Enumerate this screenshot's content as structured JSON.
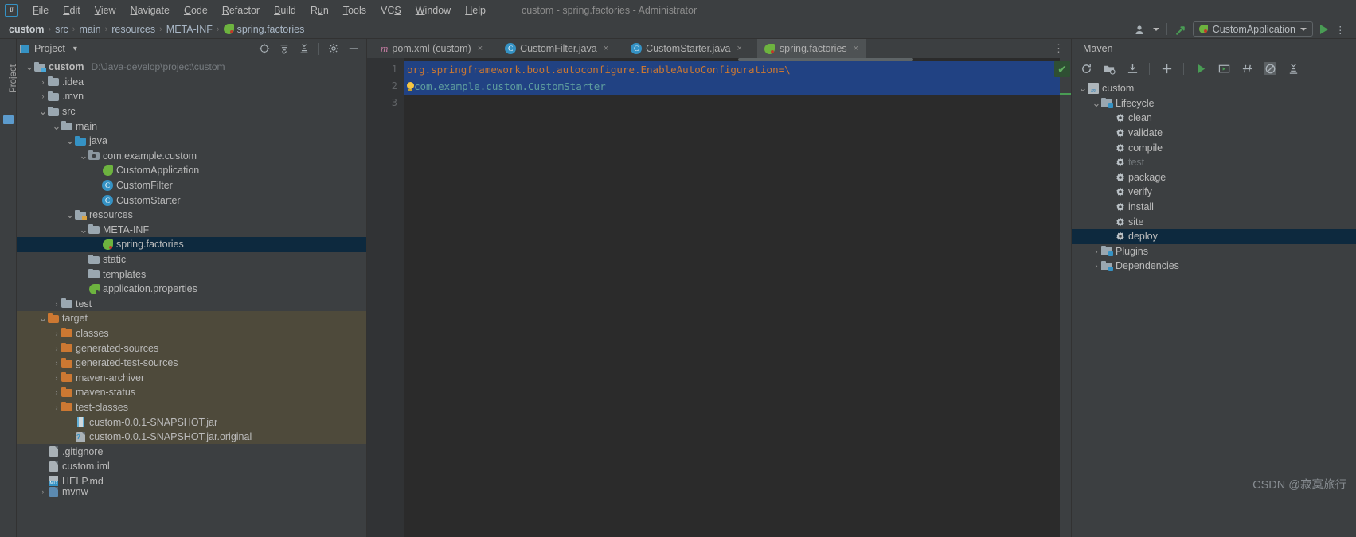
{
  "window": {
    "title": "custom - spring.factories - Administrator"
  },
  "menubar": {
    "logo": "ij-logo",
    "items": [
      "File",
      "Edit",
      "View",
      "Navigate",
      "Code",
      "Refactor",
      "Build",
      "Run",
      "Tools",
      "VCS",
      "Window",
      "Help"
    ]
  },
  "breadcrumb": {
    "items": [
      "custom",
      "src",
      "main",
      "resources",
      "META-INF",
      "spring.factories"
    ],
    "separator": "›"
  },
  "nav_right": {
    "profile_icon": "user-icon",
    "build_icon": "hammer-icon",
    "run_config": "CustomApplication",
    "run_icon": "run-icon",
    "more_icon": "more-icon"
  },
  "left_strip": {
    "label": "Project"
  },
  "project_panel": {
    "title": "Project",
    "dropdown": "▾",
    "toolbar_icons": [
      "locate-icon",
      "expand-all-icon",
      "collapse-all-icon",
      "settings-gear-icon",
      "hide-icon"
    ],
    "tree": [
      {
        "label": "custom",
        "path": "D:\\Java-develop\\project\\custom",
        "depth": 0,
        "arrow": "∨",
        "icon": "module-folder-icon",
        "bold": true
      },
      {
        "label": ".idea",
        "depth": 1,
        "arrow": "›",
        "icon": "folder-icon"
      },
      {
        "label": ".mvn",
        "depth": 1,
        "arrow": "›",
        "icon": "folder-icon"
      },
      {
        "label": "src",
        "depth": 1,
        "arrow": "∨",
        "icon": "folder-icon"
      },
      {
        "label": "main",
        "depth": 2,
        "arrow": "∨",
        "icon": "folder-icon"
      },
      {
        "label": "java",
        "depth": 3,
        "arrow": "∨",
        "icon": "source-folder-icon"
      },
      {
        "label": "com.example.custom",
        "depth": 4,
        "arrow": "∨",
        "icon": "package-icon"
      },
      {
        "label": "CustomApplication",
        "depth": 5,
        "arrow": "",
        "icon": "spring-class-icon"
      },
      {
        "label": "CustomFilter",
        "depth": 5,
        "arrow": "",
        "icon": "class-icon"
      },
      {
        "label": "CustomStarter",
        "depth": 5,
        "arrow": "",
        "icon": "class-icon"
      },
      {
        "label": "resources",
        "depth": 3,
        "arrow": "∨",
        "icon": "resource-folder-icon"
      },
      {
        "label": "META-INF",
        "depth": 4,
        "arrow": "∨",
        "icon": "folder-icon"
      },
      {
        "label": "spring.factories",
        "depth": 5,
        "arrow": "",
        "icon": "spring-leaf-icon",
        "selected": true
      },
      {
        "label": "static",
        "depth": 4,
        "arrow": "",
        "icon": "folder-icon"
      },
      {
        "label": "templates",
        "depth": 4,
        "arrow": "",
        "icon": "folder-icon"
      },
      {
        "label": "application.properties",
        "depth": 4,
        "arrow": "",
        "icon": "spring-properties-icon"
      },
      {
        "label": "test",
        "depth": 2,
        "arrow": "›",
        "icon": "folder-icon"
      },
      {
        "label": "target",
        "depth": 1,
        "arrow": "∨",
        "icon": "excluded-folder-icon",
        "excluded": true
      },
      {
        "label": "classes",
        "depth": 2,
        "arrow": "›",
        "icon": "excluded-folder-icon",
        "excluded": true
      },
      {
        "label": "generated-sources",
        "depth": 2,
        "arrow": "›",
        "icon": "excluded-folder-icon",
        "excluded": true
      },
      {
        "label": "generated-test-sources",
        "depth": 2,
        "arrow": "›",
        "icon": "excluded-folder-icon",
        "excluded": true
      },
      {
        "label": "maven-archiver",
        "depth": 2,
        "arrow": "›",
        "icon": "excluded-folder-icon",
        "excluded": true
      },
      {
        "label": "maven-status",
        "depth": 2,
        "arrow": "›",
        "icon": "excluded-folder-icon",
        "excluded": true
      },
      {
        "label": "test-classes",
        "depth": 2,
        "arrow": "›",
        "icon": "excluded-folder-icon",
        "excluded": true
      },
      {
        "label": "custom-0.0.1-SNAPSHOT.jar",
        "depth": 3,
        "arrow": "",
        "icon": "jar-icon",
        "excluded": true
      },
      {
        "label": "custom-0.0.1-SNAPSHOT.jar.original",
        "depth": 3,
        "arrow": "",
        "icon": "unknown-file-icon",
        "excluded": true
      },
      {
        "label": ".gitignore",
        "depth": 1,
        "arrow": "",
        "icon": "gitignore-icon"
      },
      {
        "label": "custom.iml",
        "depth": 1,
        "arrow": "",
        "icon": "iml-file-icon"
      },
      {
        "label": "HELP.md",
        "depth": 1,
        "arrow": "",
        "icon": "markdown-icon"
      },
      {
        "label": "mvnw",
        "depth": 1,
        "arrow": "›",
        "icon": "script-icon",
        "clipped": true
      }
    ]
  },
  "editor": {
    "tabs": [
      {
        "label": "pom.xml (custom)",
        "icon": "maven-icon",
        "active": false,
        "close": "×"
      },
      {
        "label": "CustomFilter.java",
        "icon": "class-icon",
        "active": false,
        "close": "×"
      },
      {
        "label": "CustomStarter.java",
        "icon": "class-icon",
        "active": false,
        "close": "×"
      },
      {
        "label": "spring.factories",
        "icon": "spring-leaf-icon",
        "active": true,
        "close": "×"
      }
    ],
    "tabs_overflow_icon": "more-vertical-icon",
    "gutter_lines": [
      "1",
      "2",
      "3"
    ],
    "lines": [
      {
        "num": "1",
        "text": "org.springframework.boot.autoconfigure.EnableAutoConfiguration=\\",
        "highlighted": true,
        "color": "#cc7832"
      },
      {
        "num": "2",
        "text": "com.example.custom.CustomStarter",
        "highlighted": true,
        "color": "#5f9e9e",
        "bulb": true
      },
      {
        "num": "3",
        "text": "",
        "highlighted": false,
        "color": "#a9b7c6"
      }
    ],
    "inspection_badge": "✔",
    "colors": {
      "selection": "#214283",
      "bg": "#2b2b2b",
      "gutter_bg": "#313335"
    }
  },
  "maven_panel": {
    "title": "Maven",
    "toolbar_icons": [
      "reload-icon",
      "add-module-icon",
      "download-sources-icon",
      "add-icon",
      "run-icon",
      "execute-goal-icon",
      "toggle-skip-tests-icon",
      "toggle-offline-icon",
      "collapse-all-icon"
    ],
    "tree": [
      {
        "label": "custom",
        "depth": 0,
        "arrow": "∨",
        "icon": "maven-project-icon"
      },
      {
        "label": "Lifecycle",
        "depth": 1,
        "arrow": "∨",
        "icon": "lifecycle-folder-icon"
      },
      {
        "label": "clean",
        "depth": 2,
        "arrow": "",
        "icon": "goal-gear-icon"
      },
      {
        "label": "validate",
        "depth": 2,
        "arrow": "",
        "icon": "goal-gear-icon"
      },
      {
        "label": "compile",
        "depth": 2,
        "arrow": "",
        "icon": "goal-gear-icon"
      },
      {
        "label": "test",
        "depth": 2,
        "arrow": "",
        "icon": "goal-gear-icon",
        "dimmed": true
      },
      {
        "label": "package",
        "depth": 2,
        "arrow": "",
        "icon": "goal-gear-icon"
      },
      {
        "label": "verify",
        "depth": 2,
        "arrow": "",
        "icon": "goal-gear-icon"
      },
      {
        "label": "install",
        "depth": 2,
        "arrow": "",
        "icon": "goal-gear-icon"
      },
      {
        "label": "site",
        "depth": 2,
        "arrow": "",
        "icon": "goal-gear-icon"
      },
      {
        "label": "deploy",
        "depth": 2,
        "arrow": "",
        "icon": "goal-gear-icon",
        "selected": true
      },
      {
        "label": "Plugins",
        "depth": 1,
        "arrow": "›",
        "icon": "plugins-folder-icon"
      },
      {
        "label": "Dependencies",
        "depth": 1,
        "arrow": "›",
        "icon": "dependencies-folder-icon"
      }
    ]
  },
  "watermark": {
    "text": "CSDN @寂寞旅行"
  }
}
